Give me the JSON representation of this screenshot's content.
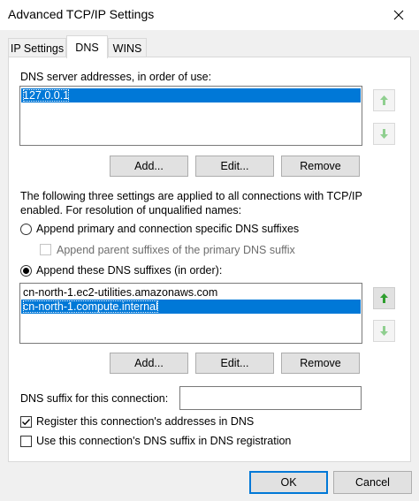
{
  "window": {
    "title": "Advanced TCP/IP Settings"
  },
  "tabs": [
    {
      "label": "IP Settings",
      "active": false
    },
    {
      "label": "DNS",
      "active": true
    },
    {
      "label": "WINS",
      "active": false
    }
  ],
  "dns_servers": {
    "label": "DNS server addresses, in order of use:",
    "items": [
      "127.0.0.1"
    ],
    "selected_index": 0,
    "buttons": {
      "add": "Add...",
      "edit": "Edit...",
      "remove": "Remove"
    }
  },
  "info_text": {
    "line1": "The following three settings are applied to all connections with TCP/IP",
    "line2": "enabled. For resolution of unqualified names:"
  },
  "options": {
    "append_primary": {
      "label": "Append primary and connection specific DNS suffixes",
      "selected": false
    },
    "append_parent": {
      "label": "Append parent suffixes of the primary DNS suffix",
      "checked": false,
      "enabled": false
    },
    "append_these": {
      "label": "Append these DNS suffixes (in order):",
      "selected": true
    }
  },
  "dns_suffixes": {
    "items": [
      "cn-north-1.ec2-utilities.amazonaws.com",
      "cn-north-1.compute.internal"
    ],
    "selected_index": 1,
    "buttons": {
      "add": "Add...",
      "edit": "Edit...",
      "remove": "Remove"
    }
  },
  "connection_suffix": {
    "label": "DNS suffix for this connection:",
    "value": ""
  },
  "register": {
    "label": "Register this connection's addresses in DNS",
    "checked": true
  },
  "use_suffix": {
    "label": "Use this connection's DNS suffix in DNS registration",
    "checked": false
  },
  "footer": {
    "ok": "OK",
    "cancel": "Cancel"
  },
  "colors": {
    "selection": "#0078d7",
    "arrow_green": "#2e9e2e",
    "arrow_green_disabled": "#8fcf8f"
  }
}
